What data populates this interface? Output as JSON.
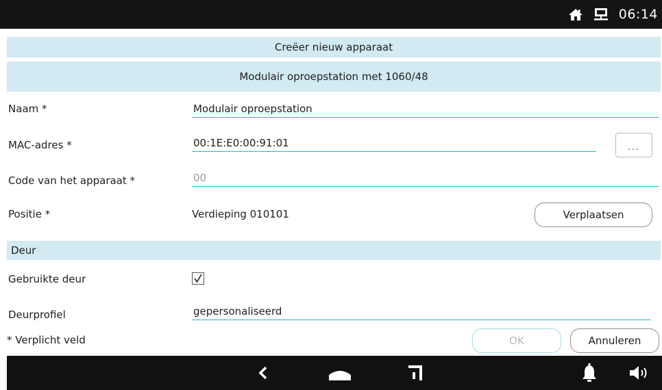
{
  "status_bar": {
    "time": "06:14",
    "icons": [
      "home-icon",
      "network-icon"
    ]
  },
  "dialog": {
    "title": "Creëer nieuw apparaat",
    "subtitle": "Modulair oproepstation met 1060/48"
  },
  "form": {
    "name": {
      "label": "Naam *",
      "value": "Modulair oproepstation"
    },
    "mac": {
      "label": "MAC-adres *",
      "value": "00:1E:E0:00:91:01",
      "button_label": "..."
    },
    "code": {
      "label": "Code van het apparaat *",
      "placeholder": "00"
    },
    "position": {
      "label": "Positie *",
      "value": "Verdieping 010101",
      "button_label": "Verplaatsen"
    }
  },
  "door_section": {
    "title": "Deur",
    "used_door": {
      "label": "Gebruikte deur",
      "checked": true
    },
    "door_profile": {
      "label": "Deurprofiel",
      "value": "gepersonaliseerd"
    }
  },
  "footer": {
    "required_note": "* Verplicht veld",
    "ok_label": "OK",
    "ok_enabled": false,
    "cancel_label": "Annuleren"
  },
  "nav_bar": {
    "buttons": [
      "back-icon",
      "home-icon",
      "recent-apps-icon",
      "bell-icon",
      "volume-icon"
    ]
  }
}
